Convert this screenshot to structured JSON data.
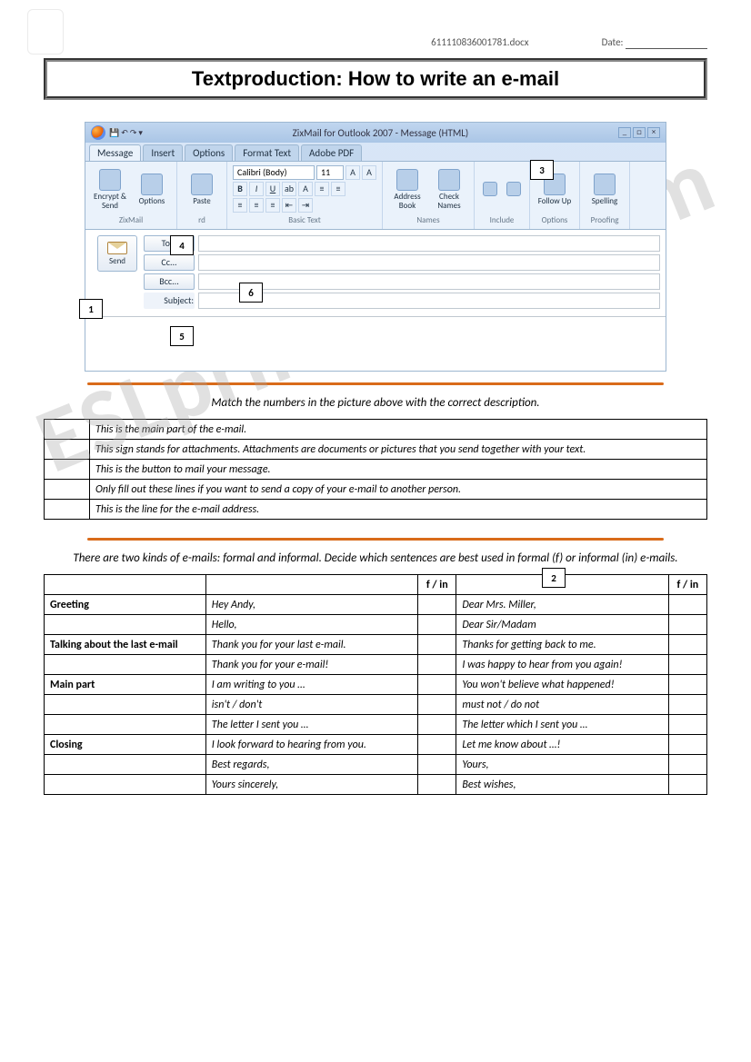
{
  "header": {
    "filename": "611110836001781.docx",
    "date_label": "Date:"
  },
  "title": "Textproduction: How to write an e-mail",
  "watermark": "ESLprintables.com",
  "outlook": {
    "window_title": "ZixMail for Outlook 2007 - Message (HTML)",
    "tabs": [
      "Message",
      "Insert",
      "Options",
      "Format Text",
      "Adobe PDF"
    ],
    "font_name": "Calibri (Body)",
    "font_size": "11",
    "groups": {
      "zixmail": "ZixMail",
      "clipboard": "rd",
      "basictext": "Basic Text",
      "names": "Names",
      "include": "Include",
      "options": "Options",
      "proofing": "Proofing"
    },
    "buttons": {
      "encrypt": "Encrypt & Send",
      "options_btn": "Options",
      "paste": "Paste",
      "address": "Address Book",
      "check": "Check Names",
      "followup": "Follow Up",
      "spelling": "Spelling"
    },
    "send": "Send",
    "fieldlabels": {
      "to": "To...",
      "cc": "Cc...",
      "bcc": "Bcc...",
      "subject": "Subject:"
    }
  },
  "labels": {
    "n1": "1",
    "n2": "2",
    "n3": "3",
    "n4": "4",
    "n5": "5",
    "n6": "6"
  },
  "instruction1": "Match the numbers in the picture above with the correct description.",
  "match_rows": [
    "This is the main part of the e-mail.",
    "This sign stands for attachments. Attachments are documents or pictures that you send together with your text.",
    "This is the button to mail your message.",
    "Only fill out these lines if you want to send a copy of your e-mail to another person.",
    "This is the line for the e-mail address."
  ],
  "instruction2": "There are two kinds of e-mails: formal and informal. Decide which sentences are best used in formal (f) or informal (in) e-mails.",
  "fi_header": "f / in",
  "fi_rows": [
    {
      "section": "Greeting",
      "left": "Hey Andy,",
      "right": "Dear Mrs. Miller,"
    },
    {
      "section": "",
      "left": "Hello,",
      "right": "Dear Sir/Madam"
    },
    {
      "section": "Talking about the last e-mail",
      "left": "Thank you for your last e-mail.",
      "right": "Thanks for getting back to me."
    },
    {
      "section": "",
      "left": "Thank you for your e-mail!",
      "right": "I was happy to hear from you again!"
    },
    {
      "section": "Main part",
      "left": "I am writing to you …",
      "right": "You won't believe what happened!"
    },
    {
      "section": "",
      "left": "isn't / don't",
      "right": "must not / do not"
    },
    {
      "section": "",
      "left": "The letter I sent you …",
      "right": "The letter which I sent you …"
    },
    {
      "section": "Closing",
      "left": "I look forward to hearing from you.",
      "right": "Let me know about …!"
    },
    {
      "section": "",
      "left": "Best regards,",
      "right": "Yours,"
    },
    {
      "section": "",
      "left": "Yours sincerely,",
      "right": "Best wishes,"
    }
  ]
}
